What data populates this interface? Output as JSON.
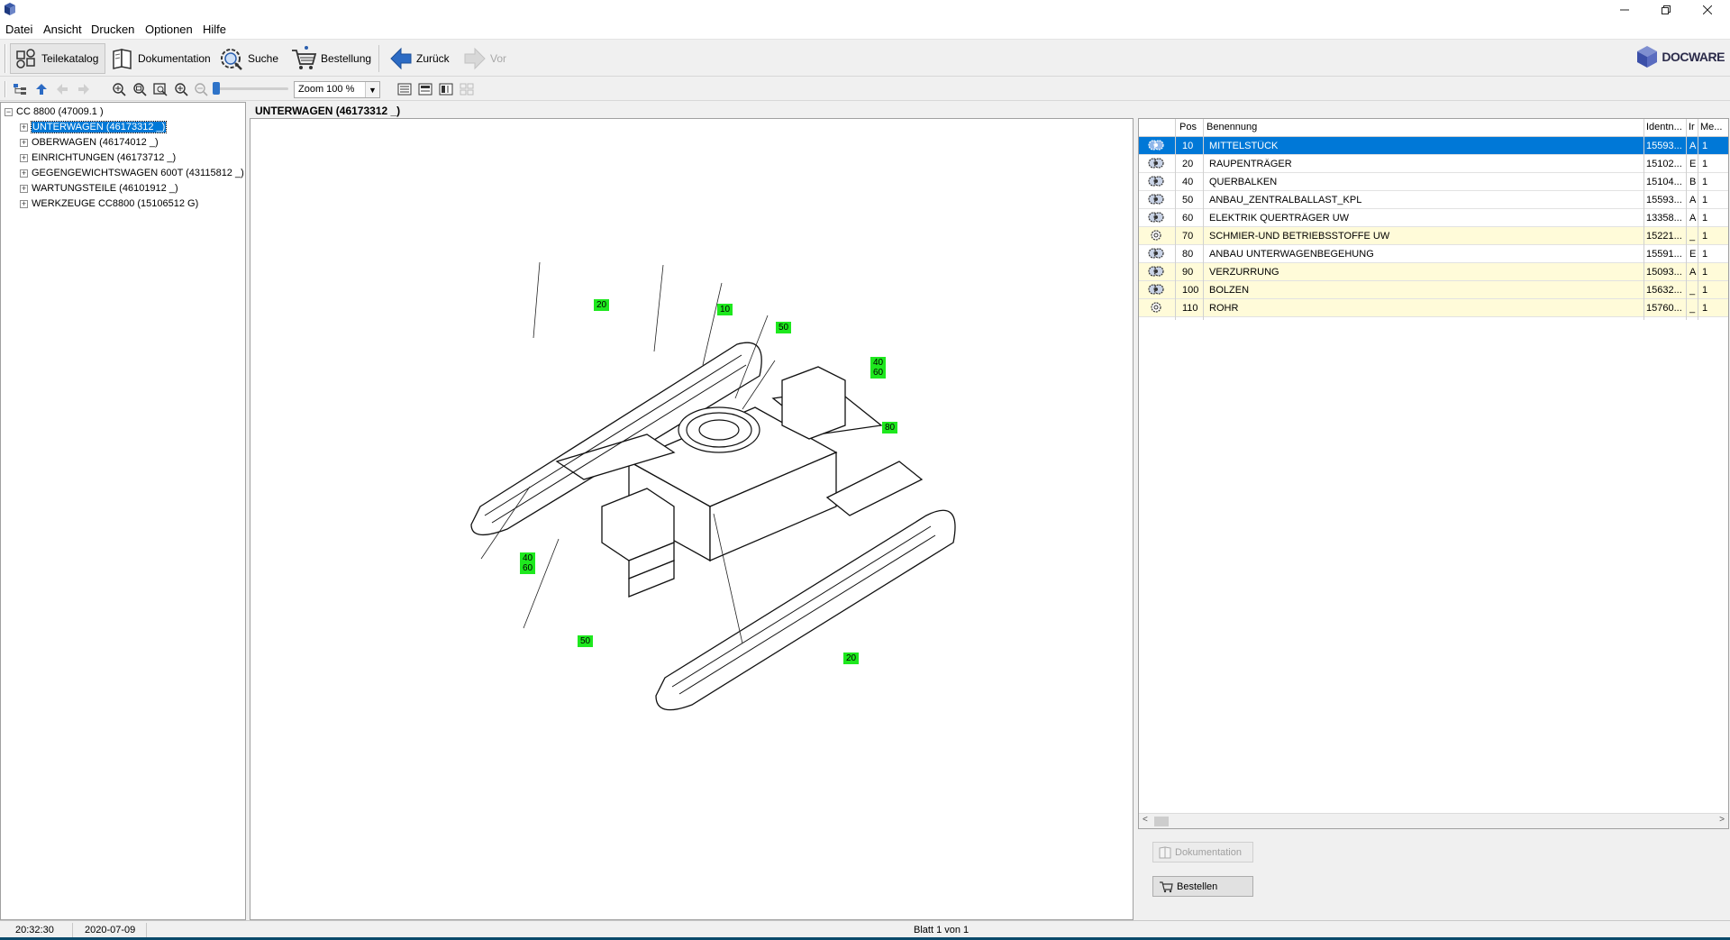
{
  "menu": {
    "items": [
      {
        "label": "Datei"
      },
      {
        "label": "Ansicht"
      },
      {
        "label": "Drucken"
      },
      {
        "label": "Optionen"
      },
      {
        "label": "Hilfe"
      }
    ]
  },
  "toolbar": {
    "teilekatalog": "Teilekatalog",
    "dokumentation": "Dokumentation",
    "suche": "Suche",
    "bestellung": "Bestellung",
    "zurueck": "Zurück",
    "vor": "Vor",
    "brand": "DOCWARE"
  },
  "zoom": {
    "value": "Zoom 100 %"
  },
  "tree": {
    "root": "CC 8800 (47009.1 )",
    "items": [
      {
        "label": "UNTERWAGEN (46173312 _)",
        "selected": true
      },
      {
        "label": "OBERWAGEN (46174012 _)"
      },
      {
        "label": "EINRICHTUNGEN (46173712 _)"
      },
      {
        "label": "GEGENGEWICHTSWAGEN 600T (43115812 _)"
      },
      {
        "label": "WARTUNGSTEILE (46101912 _)"
      },
      {
        "label": "WERKZEUGE CC8800 (15106512 G)"
      }
    ]
  },
  "drawing": {
    "title": "UNTERWAGEN (46173312 _)",
    "labels": [
      "20",
      "10",
      "50",
      "40\n60",
      "80",
      "40\n60",
      "50",
      "20"
    ]
  },
  "table": {
    "columns": [
      "Pos",
      "Benennung",
      "Identn...",
      "Ir",
      "Me..."
    ],
    "rows": [
      {
        "pos": "10",
        "name": "MITTELSTÜCK",
        "ident": "15593...",
        "ir": "A",
        "me": "1",
        "style": "selected",
        "icon": "gear-group"
      },
      {
        "pos": "20",
        "name": "RAUPENTRÄGER",
        "ident": "15102...",
        "ir": "E",
        "me": "1",
        "style": "white",
        "icon": "gear-group"
      },
      {
        "pos": "40",
        "name": "QUERBALKEN",
        "ident": "15104...",
        "ir": "B",
        "me": "1",
        "style": "white",
        "icon": "gear-group"
      },
      {
        "pos": "50",
        "name": "ANBAU_ZENTRALBALLAST_KPL",
        "ident": "15593...",
        "ir": "A",
        "me": "1",
        "style": "white",
        "icon": "gear-group"
      },
      {
        "pos": "60",
        "name": "ELEKTRIK QUERTRÄGER UW",
        "ident": "13358...",
        "ir": "A",
        "me": "1",
        "style": "white",
        "icon": "gear-group"
      },
      {
        "pos": "70",
        "name": "SCHMIER-UND BETRIEBSSTOFFE UW",
        "ident": "15221...",
        "ir": "_",
        "me": "1",
        "style": "yellow",
        "icon": "gear-single"
      },
      {
        "pos": "80",
        "name": "ANBAU UNTERWAGENBEGEHUNG",
        "ident": "15591...",
        "ir": "E",
        "me": "1",
        "style": "white",
        "icon": "gear-group"
      },
      {
        "pos": "90",
        "name": "VERZURRUNG",
        "ident": "15093...",
        "ir": "A",
        "me": "1",
        "style": "yellow",
        "icon": "gear-group"
      },
      {
        "pos": "100",
        "name": "BOLZEN",
        "ident": "15632...",
        "ir": "_",
        "me": "1",
        "style": "yellow",
        "icon": "gear-group"
      },
      {
        "pos": "110",
        "name": "ROHR",
        "ident": "15760...",
        "ir": "_",
        "me": "1",
        "style": "yellow",
        "icon": "gear-single"
      }
    ]
  },
  "actions": {
    "dokumentation": "Dokumentation",
    "bestellen": "Bestellen"
  },
  "status": {
    "time": "20:32:30",
    "date": "2020-07-09",
    "page": "Blatt 1 von 1"
  },
  "colors": {
    "selection": "#0078d7",
    "label_green": "#1ee81e",
    "row_yellow": "#fffbd9"
  }
}
